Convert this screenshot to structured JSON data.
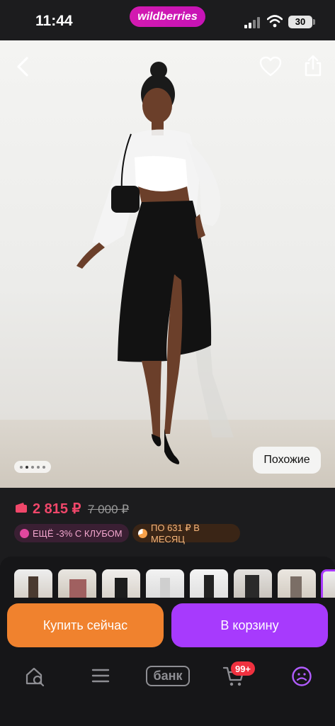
{
  "status_bar": {
    "time": "11:44",
    "brand": "wildberries",
    "battery": "30",
    "icons": [
      "signal-icon",
      "wifi-icon",
      "battery-icon"
    ]
  },
  "gallery": {
    "similar_label": "Похожие",
    "icons": [
      "back-chevron-icon",
      "heart-icon",
      "share-icon"
    ]
  },
  "price": {
    "current": "2 815 ₽",
    "old": "7 000 ₽",
    "club_offer": "ЕЩЁ -3% С КЛУБОМ",
    "installment": "ПО 631 ₽ В МЕСЯЦ"
  },
  "actions": {
    "buy_now": "Купить сейчас",
    "add_to_cart": "В корзину"
  },
  "tabbar": {
    "bank_label": "банк",
    "cart_badge": "99+",
    "icons": [
      "home-search-icon",
      "catalog-menu-icon",
      "bank-icon",
      "cart-icon",
      "profile-icon"
    ]
  },
  "colors": {
    "brand": "#cb11ab",
    "price": "#f0476a",
    "buy_now": "#f0822e",
    "cart": "#a73afd"
  }
}
